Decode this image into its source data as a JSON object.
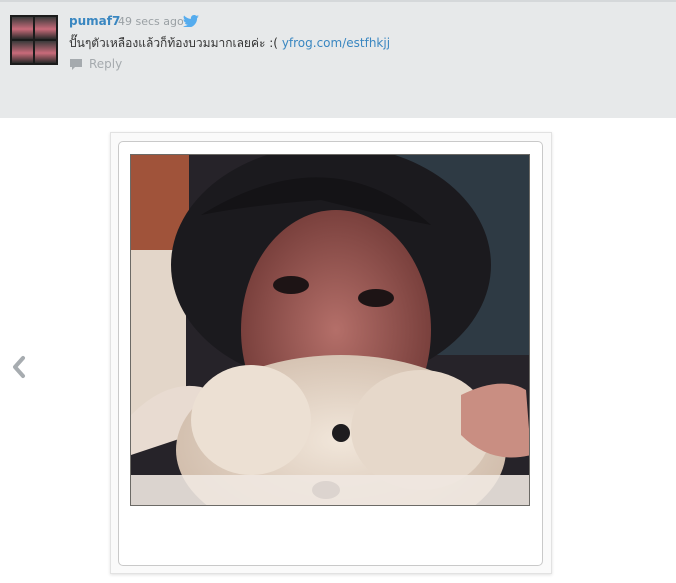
{
  "tweet": {
    "username": "pumaf7",
    "timestamp": "49 secs ago",
    "text": "ปั๊นๆตัวเหลืองแล้วก็ท้องบวมมากเลยค่ะ :(",
    "link": "yfrog.com/estfhkjj",
    "reply_label": "Reply",
    "icons": [
      "avatar",
      "twitter-bird-icon",
      "reply-icon"
    ]
  },
  "viewer": {
    "nav_prev_icon": "chevron-left-icon",
    "image": "photo-girl-with-white-dog"
  },
  "colors": {
    "link": "#3a87c1",
    "header_bg": "#e7e9ea",
    "muted": "#9aa0a4"
  }
}
